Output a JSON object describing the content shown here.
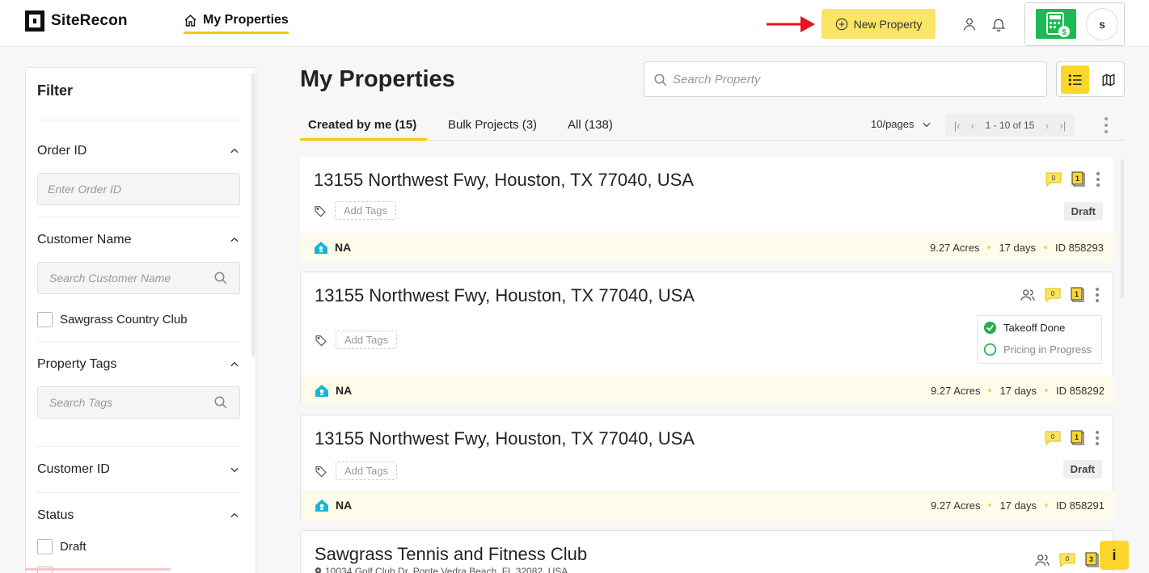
{
  "header": {
    "brand": "SiteRecon",
    "nav_label": "My Properties",
    "new_property_label": "New Property",
    "avatar_initial": "s",
    "icons": {
      "home": "home-icon",
      "plus": "plus-circle-icon",
      "user": "user-icon",
      "bell": "bell-icon",
      "calculator": "calculator-dollar-icon"
    },
    "accent_color": "#f5c800"
  },
  "sidebar": {
    "title": "Filter",
    "order_id": {
      "label": "Order ID",
      "placeholder": "Enter Order ID"
    },
    "customer_name": {
      "label": "Customer Name",
      "placeholder": "Search Customer Name",
      "options": [
        "Sawgrass Country Club"
      ]
    },
    "property_tags": {
      "label": "Property Tags",
      "placeholder": "Search Tags"
    },
    "customer_id": {
      "label": "Customer ID"
    },
    "status": {
      "label": "Status",
      "options": [
        "Draft"
      ]
    }
  },
  "main": {
    "title": "My Properties",
    "search_placeholder": "Search Property",
    "tabs": [
      {
        "label": "Created by me (15)",
        "active": true
      },
      {
        "label": "Bulk Projects (3)",
        "active": false
      },
      {
        "label": "All (138)",
        "active": false
      }
    ],
    "per_page": "10/pages",
    "pager_range": "1 - 10 of 15",
    "add_tags_label": "Add Tags"
  },
  "properties": [
    {
      "title": "13155 Northwest Fwy, Houston, TX 77040, USA",
      "comments": "0",
      "notes": "1",
      "status": "Draft",
      "customer": "NA",
      "acres": "9.27 Acres",
      "age": "17 days",
      "id": "ID 858293"
    },
    {
      "title": "13155 Northwest Fwy, Houston, TX 77040, USA",
      "comments": "0",
      "notes": "1",
      "steps": [
        {
          "label": "Takeoff Done",
          "done": true
        },
        {
          "label": "Pricing in Progress",
          "done": false
        }
      ],
      "customer": "NA",
      "acres": "9.27 Acres",
      "age": "17 days",
      "id": "ID 858292"
    },
    {
      "title": "13155 Northwest Fwy, Houston, TX 77040, USA",
      "comments": "0",
      "notes": "1",
      "status": "Draft",
      "customer": "NA",
      "acres": "9.27 Acres",
      "age": "17 days",
      "id": "ID 858291"
    },
    {
      "title": "Sawgrass Tennis and Fitness Club",
      "address": "10034 Golf Club Dr, Ponte Vedra Beach, FL 32082, USA",
      "comments": "0",
      "notes": "3"
    }
  ],
  "info_button": "i"
}
